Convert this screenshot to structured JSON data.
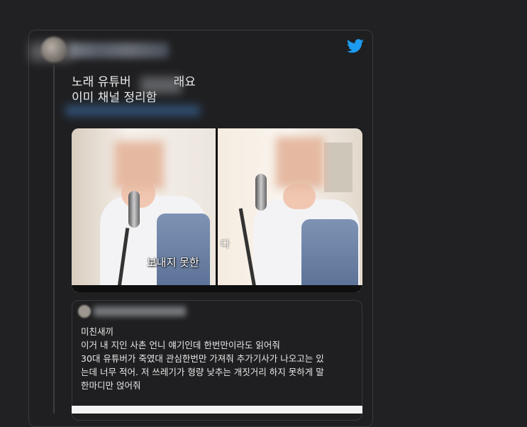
{
  "tweet": {
    "line1": "노래 유튜버",
    "line1_suffix": "래요",
    "line2": "이미 채널 정리함"
  },
  "media": {
    "overlay_left": "보내지 못한 ",
    "overlay_right": "다"
  },
  "quote": {
    "lines": [
      "미친새끼",
      "이거 내 지인 사촌 언니 얘기인데 한번만이라도 읽어줘",
      "30대 유튜버가 죽였대 관심한번만 가져줘 추가기사가 나오고는 있",
      "는데 너무 적어. 저 쓰레기가 형량 낮추는 개짓거리 하지 못하게 말",
      "한마디만 얹어줘"
    ]
  },
  "colors": {
    "background": "#212123",
    "card": "#1f1f21",
    "twitter_blue": "#1d9bf0",
    "text": "#ededed"
  },
  "icons": {
    "brand": "twitter-icon"
  }
}
